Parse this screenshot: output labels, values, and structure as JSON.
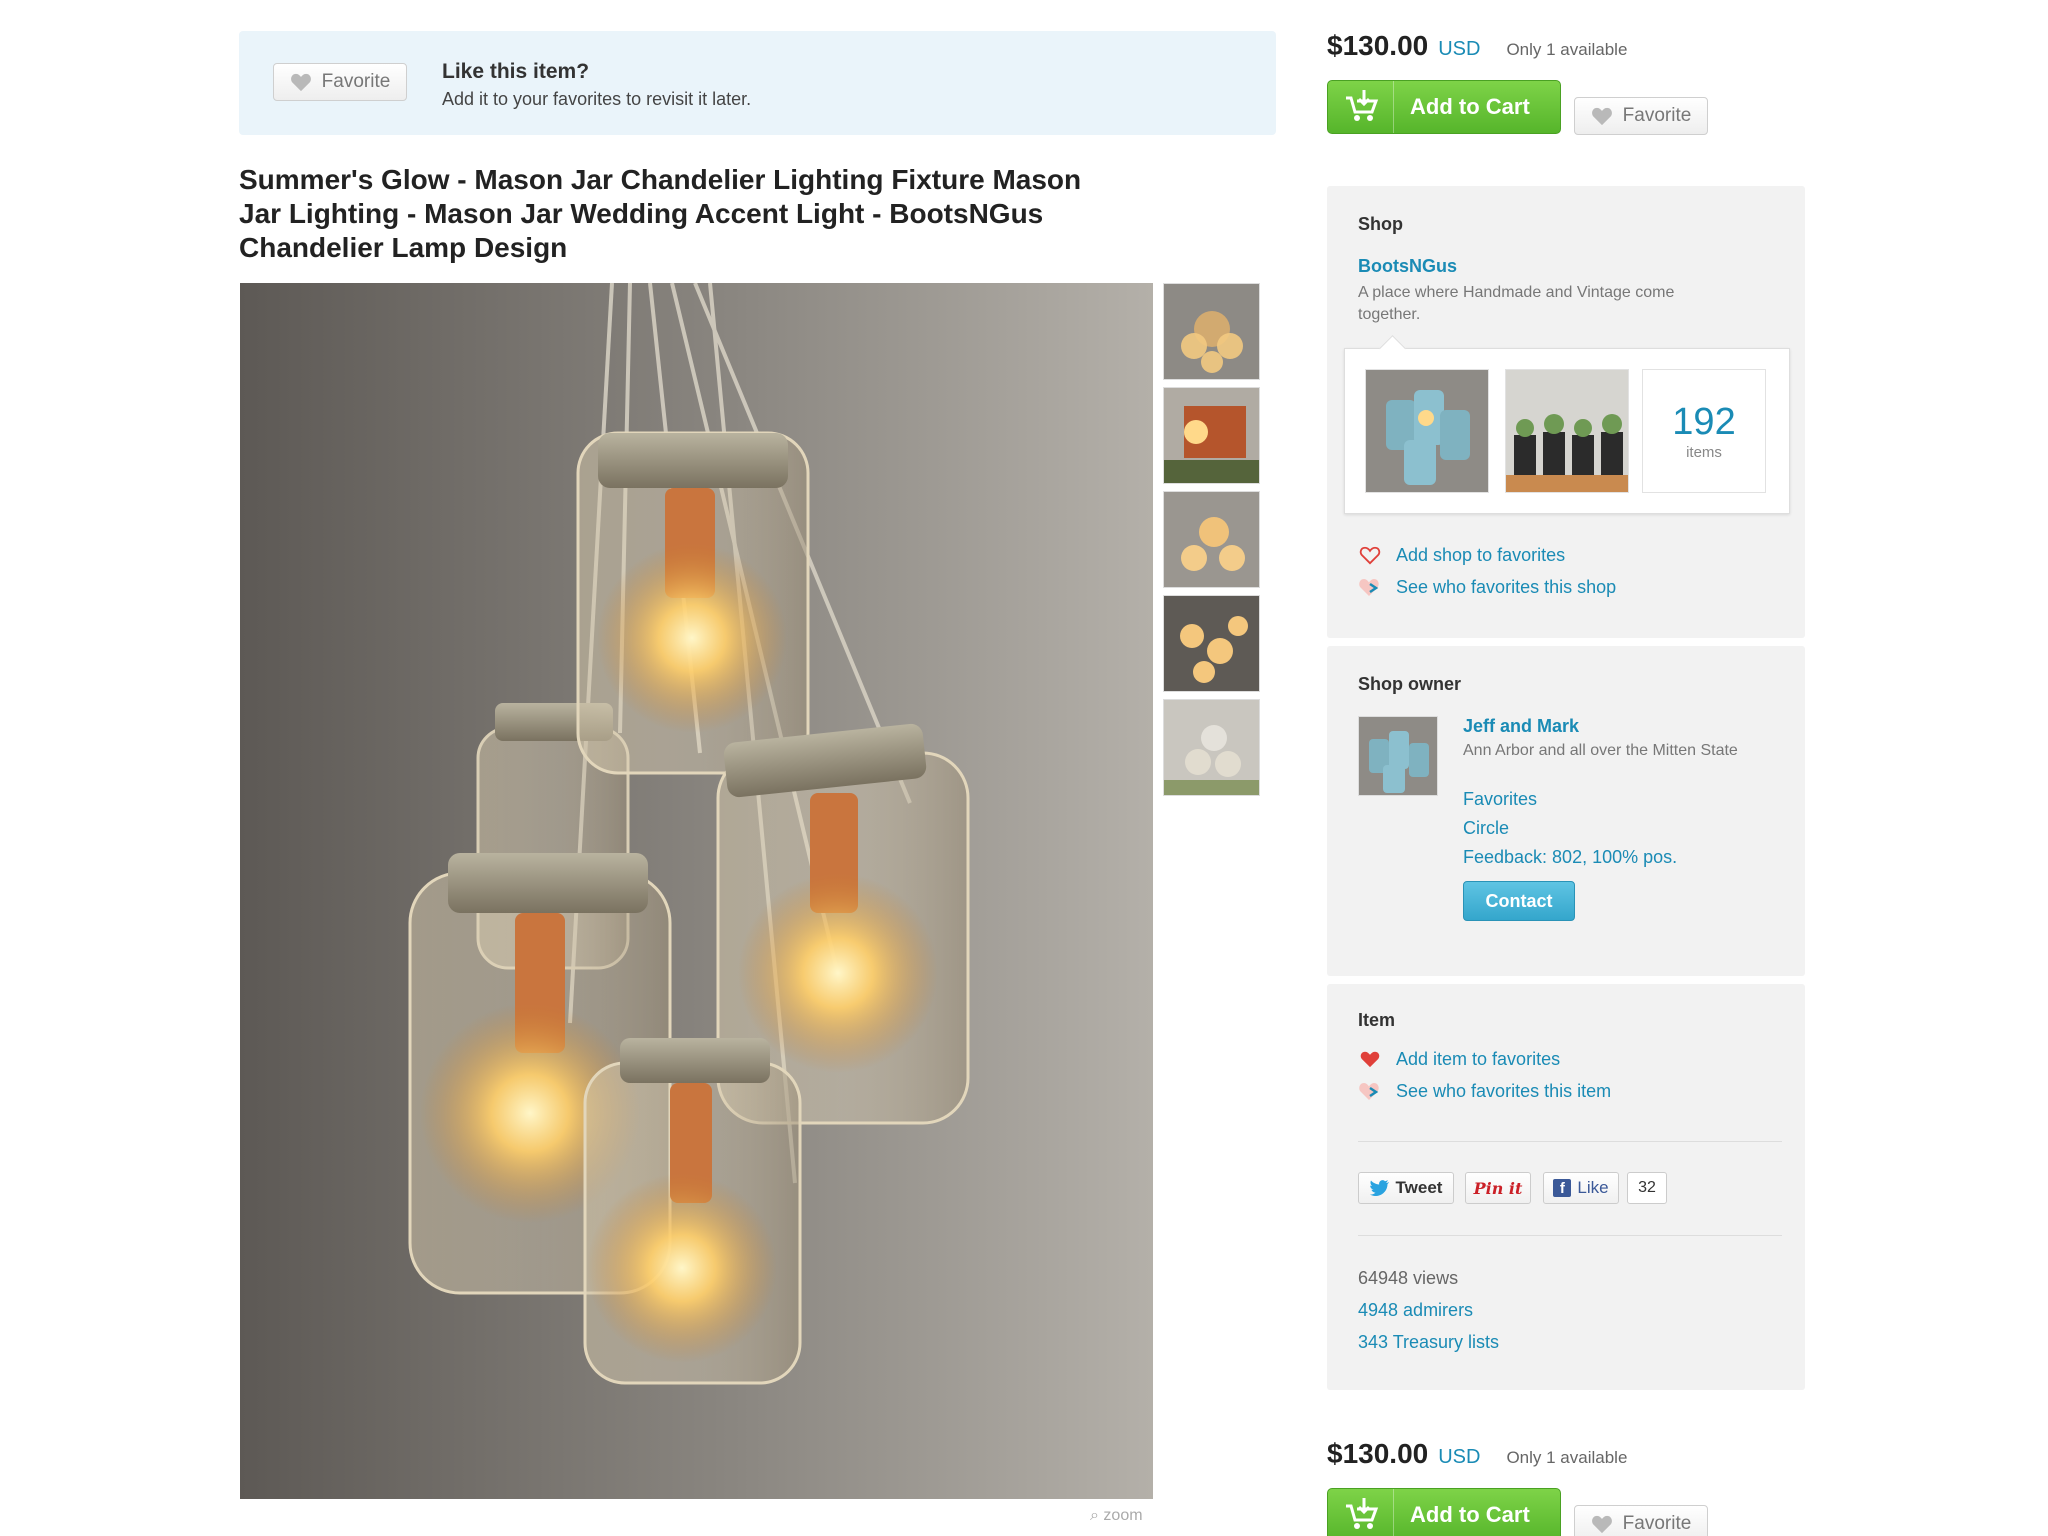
{
  "like_banner": {
    "favorite_label": "Favorite",
    "title": "Like this item?",
    "subtitle": "Add it to your favorites to revisit it later."
  },
  "item": {
    "title": "Summer's Glow - Mason Jar Chandelier Lighting Fixture Mason Jar Lighting - Mason Jar Wedding Accent Light - BootsNGus Chandelier Lamp Design",
    "zoom_label": "zoom",
    "thumbnail_count": 5
  },
  "purchase": {
    "price": "$130.00",
    "currency": "USD",
    "availability": "Only 1 available",
    "add_to_cart_label": "Add to Cart",
    "favorite_label": "Favorite"
  },
  "shop": {
    "heading": "Shop",
    "name": "BootsNGus",
    "description": "A place where Handmade and Vintage come together.",
    "items_count": "192",
    "items_label": "items",
    "add_to_favorites": "Add shop to favorites",
    "see_who_favorites": "See who favorites this shop"
  },
  "owner": {
    "heading": "Shop owner",
    "name": "Jeff and Mark",
    "location": "Ann Arbor and all over the Mitten State",
    "favorites_link": "Favorites",
    "circle_link": "Circle",
    "feedback": "Feedback: 802, 100% pos.",
    "contact_label": "Contact"
  },
  "item_panel": {
    "heading": "Item",
    "add_to_favorites": "Add item to favorites",
    "see_who_favorites": "See who favorites this item",
    "tweet_label": "Tweet",
    "pin_label": "Pin it",
    "like_label": "Like",
    "like_count": "32",
    "views": "64948 views",
    "admirers": "4948 admirers",
    "treasury": "343 Treasury lists"
  },
  "colors": {
    "link": "#1a8bb5",
    "cart_green": "#56b52b",
    "contact_blue": "#34a6cc",
    "banner_bg": "#eaf4fa",
    "heart_red": "#e0403a"
  }
}
